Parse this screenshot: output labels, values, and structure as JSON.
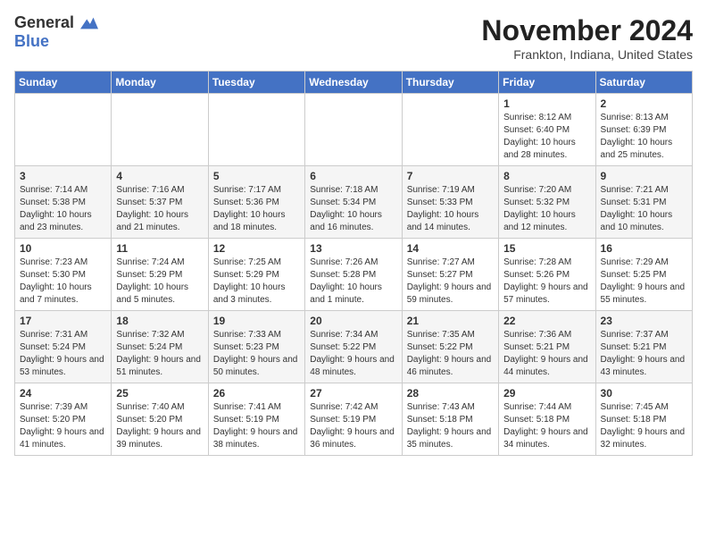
{
  "header": {
    "logo_general": "General",
    "logo_blue": "Blue",
    "title": "November 2024",
    "subtitle": "Frankton, Indiana, United States"
  },
  "weekdays": [
    "Sunday",
    "Monday",
    "Tuesday",
    "Wednesday",
    "Thursday",
    "Friday",
    "Saturday"
  ],
  "weeks": [
    [
      {
        "day": "",
        "info": ""
      },
      {
        "day": "",
        "info": ""
      },
      {
        "day": "",
        "info": ""
      },
      {
        "day": "",
        "info": ""
      },
      {
        "day": "",
        "info": ""
      },
      {
        "day": "1",
        "info": "Sunrise: 8:12 AM\nSunset: 6:40 PM\nDaylight: 10 hours and 28 minutes."
      },
      {
        "day": "2",
        "info": "Sunrise: 8:13 AM\nSunset: 6:39 PM\nDaylight: 10 hours and 25 minutes."
      }
    ],
    [
      {
        "day": "3",
        "info": "Sunrise: 7:14 AM\nSunset: 5:38 PM\nDaylight: 10 hours and 23 minutes."
      },
      {
        "day": "4",
        "info": "Sunrise: 7:16 AM\nSunset: 5:37 PM\nDaylight: 10 hours and 21 minutes."
      },
      {
        "day": "5",
        "info": "Sunrise: 7:17 AM\nSunset: 5:36 PM\nDaylight: 10 hours and 18 minutes."
      },
      {
        "day": "6",
        "info": "Sunrise: 7:18 AM\nSunset: 5:34 PM\nDaylight: 10 hours and 16 minutes."
      },
      {
        "day": "7",
        "info": "Sunrise: 7:19 AM\nSunset: 5:33 PM\nDaylight: 10 hours and 14 minutes."
      },
      {
        "day": "8",
        "info": "Sunrise: 7:20 AM\nSunset: 5:32 PM\nDaylight: 10 hours and 12 minutes."
      },
      {
        "day": "9",
        "info": "Sunrise: 7:21 AM\nSunset: 5:31 PM\nDaylight: 10 hours and 10 minutes."
      }
    ],
    [
      {
        "day": "10",
        "info": "Sunrise: 7:23 AM\nSunset: 5:30 PM\nDaylight: 10 hours and 7 minutes."
      },
      {
        "day": "11",
        "info": "Sunrise: 7:24 AM\nSunset: 5:29 PM\nDaylight: 10 hours and 5 minutes."
      },
      {
        "day": "12",
        "info": "Sunrise: 7:25 AM\nSunset: 5:29 PM\nDaylight: 10 hours and 3 minutes."
      },
      {
        "day": "13",
        "info": "Sunrise: 7:26 AM\nSunset: 5:28 PM\nDaylight: 10 hours and 1 minute."
      },
      {
        "day": "14",
        "info": "Sunrise: 7:27 AM\nSunset: 5:27 PM\nDaylight: 9 hours and 59 minutes."
      },
      {
        "day": "15",
        "info": "Sunrise: 7:28 AM\nSunset: 5:26 PM\nDaylight: 9 hours and 57 minutes."
      },
      {
        "day": "16",
        "info": "Sunrise: 7:29 AM\nSunset: 5:25 PM\nDaylight: 9 hours and 55 minutes."
      }
    ],
    [
      {
        "day": "17",
        "info": "Sunrise: 7:31 AM\nSunset: 5:24 PM\nDaylight: 9 hours and 53 minutes."
      },
      {
        "day": "18",
        "info": "Sunrise: 7:32 AM\nSunset: 5:24 PM\nDaylight: 9 hours and 51 minutes."
      },
      {
        "day": "19",
        "info": "Sunrise: 7:33 AM\nSunset: 5:23 PM\nDaylight: 9 hours and 50 minutes."
      },
      {
        "day": "20",
        "info": "Sunrise: 7:34 AM\nSunset: 5:22 PM\nDaylight: 9 hours and 48 minutes."
      },
      {
        "day": "21",
        "info": "Sunrise: 7:35 AM\nSunset: 5:22 PM\nDaylight: 9 hours and 46 minutes."
      },
      {
        "day": "22",
        "info": "Sunrise: 7:36 AM\nSunset: 5:21 PM\nDaylight: 9 hours and 44 minutes."
      },
      {
        "day": "23",
        "info": "Sunrise: 7:37 AM\nSunset: 5:21 PM\nDaylight: 9 hours and 43 minutes."
      }
    ],
    [
      {
        "day": "24",
        "info": "Sunrise: 7:39 AM\nSunset: 5:20 PM\nDaylight: 9 hours and 41 minutes."
      },
      {
        "day": "25",
        "info": "Sunrise: 7:40 AM\nSunset: 5:20 PM\nDaylight: 9 hours and 39 minutes."
      },
      {
        "day": "26",
        "info": "Sunrise: 7:41 AM\nSunset: 5:19 PM\nDaylight: 9 hours and 38 minutes."
      },
      {
        "day": "27",
        "info": "Sunrise: 7:42 AM\nSunset: 5:19 PM\nDaylight: 9 hours and 36 minutes."
      },
      {
        "day": "28",
        "info": "Sunrise: 7:43 AM\nSunset: 5:18 PM\nDaylight: 9 hours and 35 minutes."
      },
      {
        "day": "29",
        "info": "Sunrise: 7:44 AM\nSunset: 5:18 PM\nDaylight: 9 hours and 34 minutes."
      },
      {
        "day": "30",
        "info": "Sunrise: 7:45 AM\nSunset: 5:18 PM\nDaylight: 9 hours and 32 minutes."
      }
    ]
  ]
}
